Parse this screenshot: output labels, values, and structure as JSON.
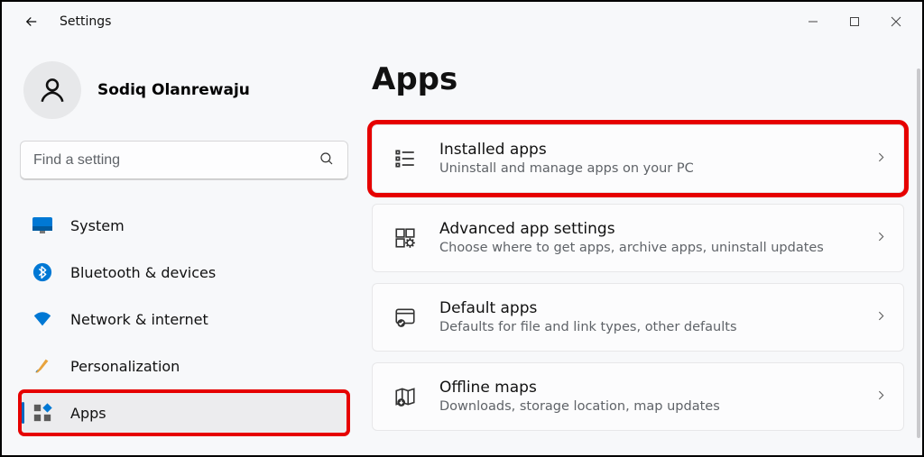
{
  "window": {
    "title": "Settings"
  },
  "profile": {
    "name": "Sodiq Olanrewaju"
  },
  "search": {
    "placeholder": "Find a setting"
  },
  "sidebar": {
    "items": [
      {
        "label": "System"
      },
      {
        "label": "Bluetooth & devices"
      },
      {
        "label": "Network & internet"
      },
      {
        "label": "Personalization"
      },
      {
        "label": "Apps"
      }
    ]
  },
  "page": {
    "title": "Apps"
  },
  "cards": [
    {
      "title": "Installed apps",
      "desc": "Uninstall and manage apps on your PC"
    },
    {
      "title": "Advanced app settings",
      "desc": "Choose where to get apps, archive apps, uninstall updates"
    },
    {
      "title": "Default apps",
      "desc": "Defaults for file and link types, other defaults"
    },
    {
      "title": "Offline maps",
      "desc": "Downloads, storage location, map updates"
    }
  ]
}
